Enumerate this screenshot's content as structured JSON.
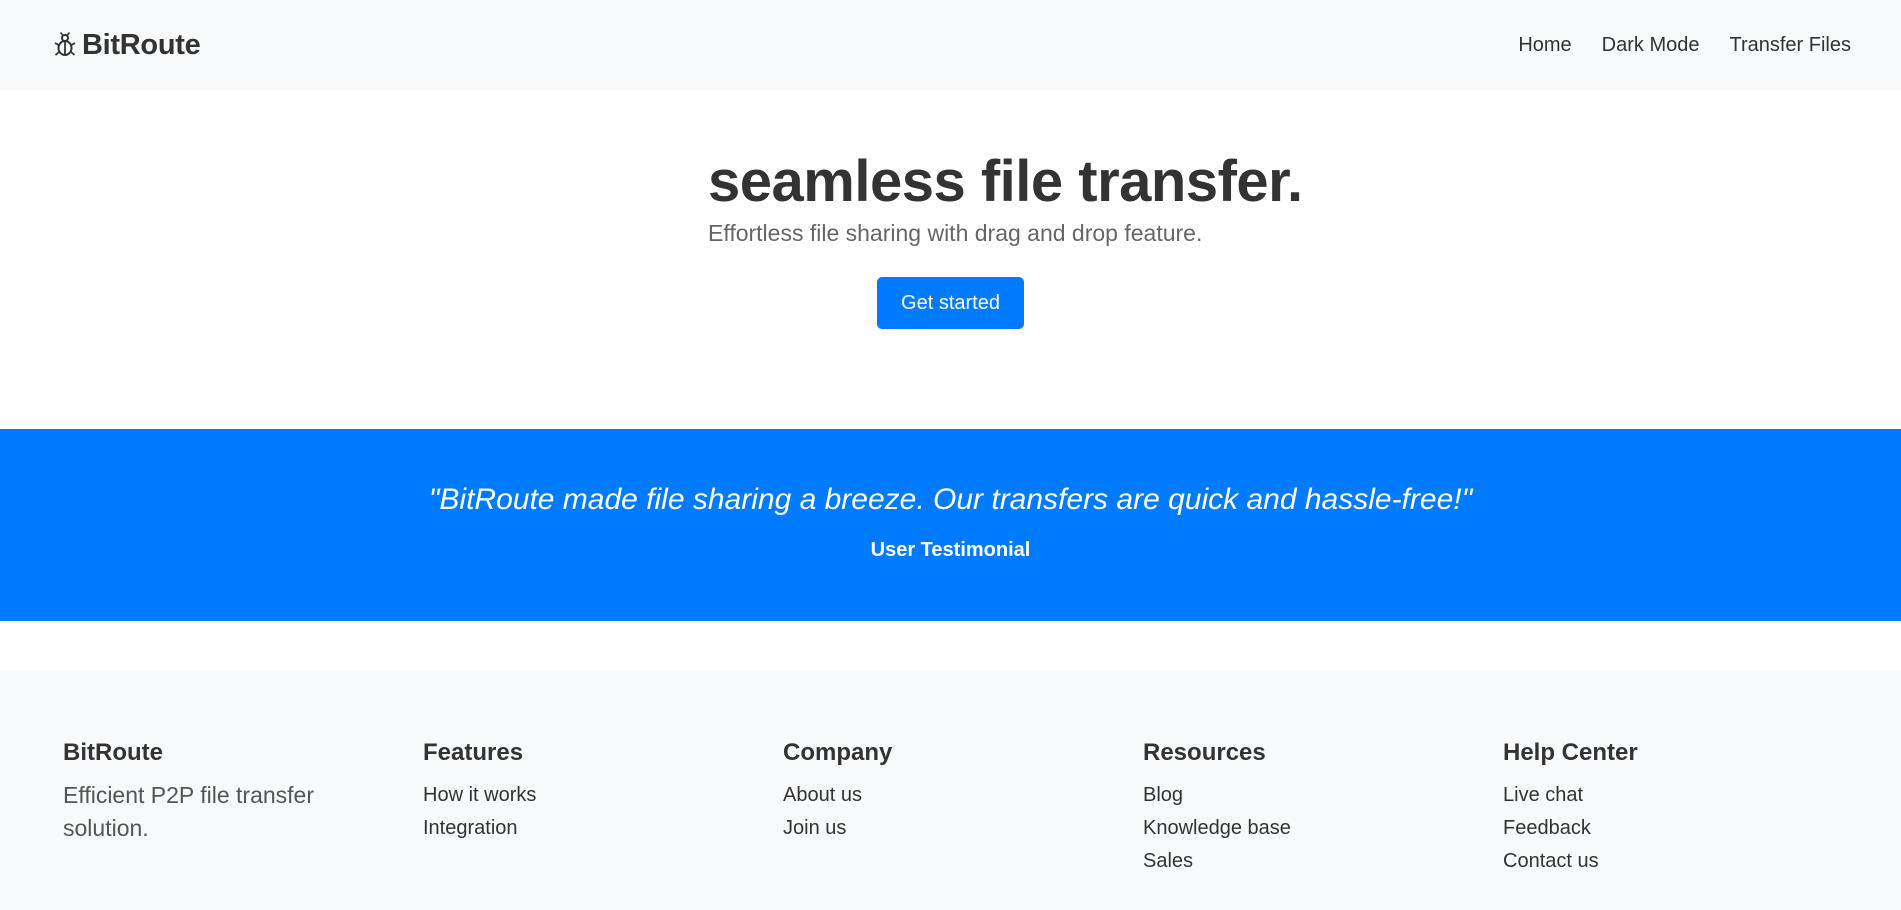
{
  "colors": {
    "accent": "#007bff",
    "navbar_bg": "#f8f9fa",
    "footer_bg": "#f8f9fa",
    "text": "#333333"
  },
  "header": {
    "brand": {
      "icon": "beetle-logo-icon",
      "name": "BitRoute"
    },
    "nav": [
      {
        "label": "Home"
      },
      {
        "label": "Dark Mode"
      },
      {
        "label": "Transfer Files"
      }
    ]
  },
  "hero": {
    "title": "seamless file transfer.",
    "subtitle": "Effortless file sharing with drag and drop feature.",
    "cta_label": "Get started"
  },
  "testimonial": {
    "quote": "\"BitRoute made file sharing a breeze. Our transfers are quick and hassle-free!\"",
    "author": "User Testimonial"
  },
  "footer": {
    "about": {
      "heading": "BitRoute",
      "description": "Efficient P2P file transfer solution."
    },
    "columns": [
      {
        "heading": "Features",
        "links": [
          "How it works",
          "Integration"
        ]
      },
      {
        "heading": "Company",
        "links": [
          "About us",
          "Join us"
        ]
      },
      {
        "heading": "Resources",
        "links": [
          "Blog",
          "Knowledge base",
          "Sales"
        ]
      },
      {
        "heading": "Help Center",
        "links": [
          "Live chat",
          "Feedback",
          "Contact us"
        ]
      }
    ]
  }
}
